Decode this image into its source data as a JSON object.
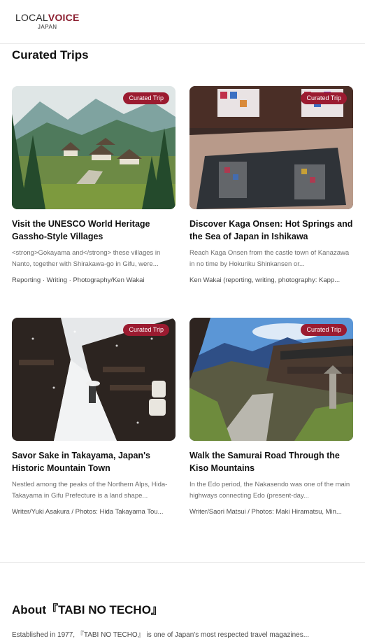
{
  "header": {
    "logo_part1": "LOCAL",
    "logo_part2": "VOICE",
    "logo_sub": "JAPAN"
  },
  "section": {
    "title": "Curated Trips"
  },
  "cards": [
    {
      "badge": "Curated Trip",
      "title": "Visit the UNESCO World Heritage Gassho-Style Villages",
      "desc": "<strong>Gokayama and</strong> these villages in Nanto, together with Shirakawa-go in Gifu, were...",
      "credit": "Reporting · Writing · Photography/Ken Wakai",
      "image": "mountain-village-photo"
    },
    {
      "badge": "Curated Trip",
      "title": "Discover Kaga Onsen: Hot Springs and the Sea of Japan in Ishikawa",
      "desc": "Reach Kaga Onsen from the castle town of Kanazawa in no time by Hokuriku Shinkansen or...",
      "credit": "Ken Wakai (reporting, writing, photography: Kapp...",
      "image": "onsen-bath-photo"
    },
    {
      "badge": "Curated Trip",
      "title": "Savor Sake in Takayama, Japan's Historic Mountain Town",
      "desc": "Nestled among the peaks of the Northern Alps, Hida-Takayama in Gifu Prefecture is a land shape...",
      "credit": "Writer/Yuki Asakura / Photos: Hida Takayama Tou...",
      "image": "snowy-street-photo"
    },
    {
      "badge": "Curated Trip",
      "title": "Walk the Samurai Road Through the Kiso Mountains",
      "desc": "In the Edo period, the Nakasendo was one of the main highways connecting Edo (present-day...",
      "credit": "Writer/Saori Matsui / Photos: Maki Hiramatsu, Min...",
      "image": "nakasendo-road-photo"
    }
  ],
  "about": {
    "title": "About『TABI NO TECHO』",
    "text": "Established in 1977, 『TABI NO TECHO』 is one of Japan's most respected travel magazines..."
  },
  "colors": {
    "accent": "#9b1b30",
    "brand": "#8b1e2f"
  }
}
